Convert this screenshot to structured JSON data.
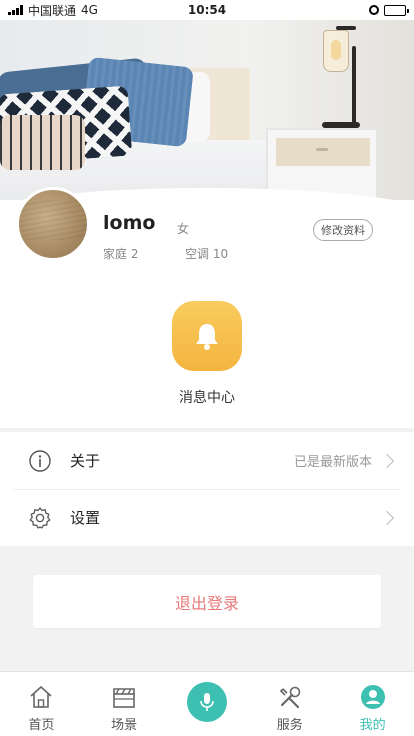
{
  "status_bar": {
    "carrier": "中国联通",
    "network": "4G",
    "time": "10:54"
  },
  "profile": {
    "name": "lomo",
    "gender": "女",
    "family_label": "家庭",
    "family_count": "2",
    "ac_label": "空调",
    "ac_count": "10",
    "edit_label": "修改资料"
  },
  "message_center": {
    "label": "消息中心",
    "icon": "bell-icon"
  },
  "menu": [
    {
      "label": "关于",
      "value": "已是最新版本",
      "icon": "info-icon"
    },
    {
      "label": "设置",
      "value": "",
      "icon": "gear-icon"
    }
  ],
  "logout_label": "退出登录",
  "tabbar": {
    "accent": "#3dbfb2",
    "items": [
      {
        "label": "首页",
        "icon": "home-icon"
      },
      {
        "label": "场景",
        "icon": "clapper-icon"
      },
      {
        "label": "",
        "icon": "mic-icon"
      },
      {
        "label": "服务",
        "icon": "tools-icon"
      },
      {
        "label": "我的",
        "icon": "user-icon",
        "active": true
      }
    ]
  }
}
